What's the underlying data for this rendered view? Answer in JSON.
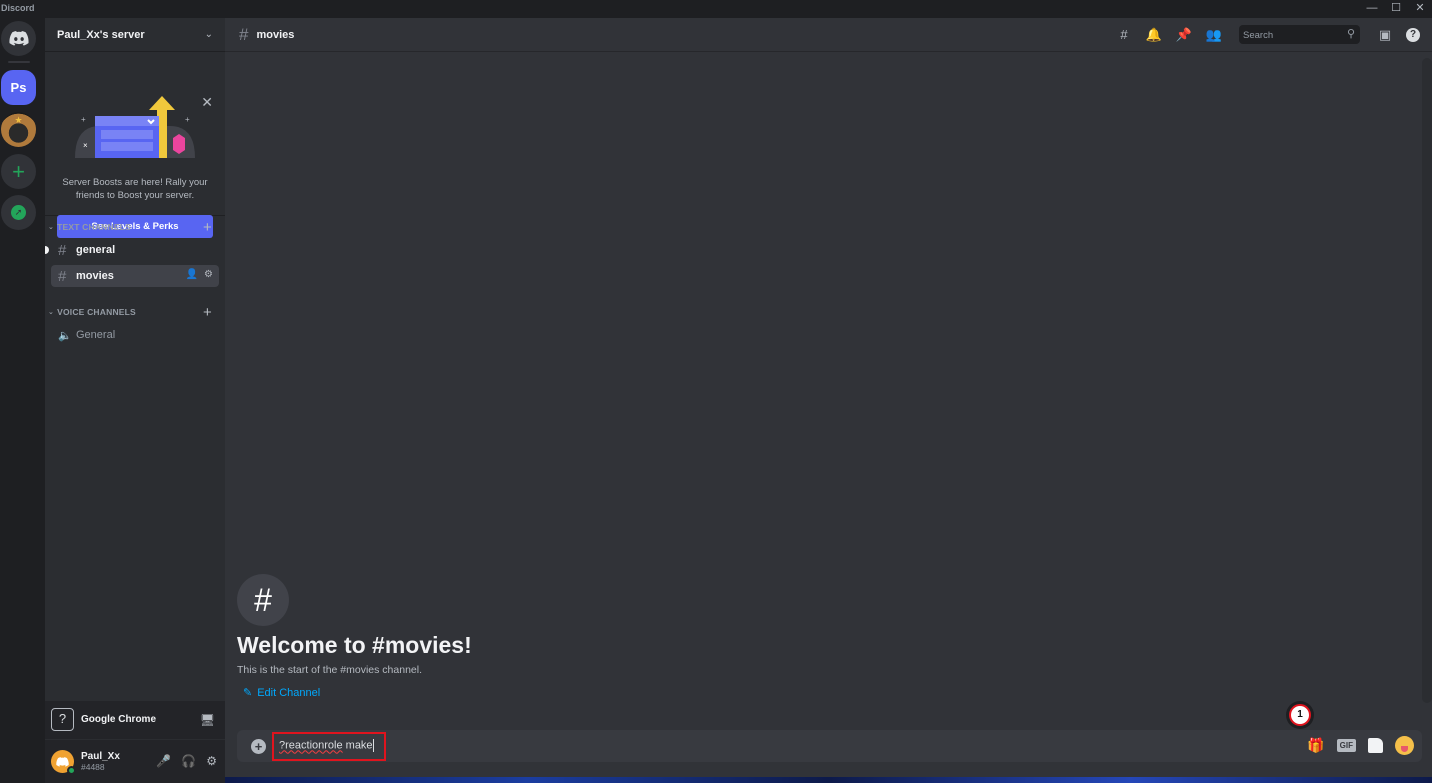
{
  "window": {
    "app_name": "Discord",
    "controls": {
      "minimize": "—",
      "maximize": "☐",
      "close": "✕"
    }
  },
  "guilds": {
    "home_icon": "discord-logo-icon",
    "items": [
      {
        "label": "Ps",
        "selected": true
      },
      {
        "label": "",
        "icon": "server-avatar-image"
      }
    ],
    "add_label": "+",
    "explore_icon": "compass-icon"
  },
  "server": {
    "name": "Paul_Xx's server",
    "chevron": "⌄"
  },
  "boost_banner": {
    "close": "✕",
    "text": "Server Boosts are here! Rally your friends to Boost your server.",
    "button": "See Levels & Perks"
  },
  "channels": {
    "text_category": "TEXT CHANNELS",
    "voice_category": "VOICE CHANNELS",
    "text": [
      {
        "name": "general",
        "unread": true,
        "selected": false
      },
      {
        "name": "movies",
        "unread": false,
        "selected": true
      }
    ],
    "voice": [
      {
        "name": "General"
      }
    ]
  },
  "activity": {
    "icon": "?",
    "name": "Google Chrome"
  },
  "user": {
    "name": "Paul_Xx",
    "tag": "#4488",
    "status": "online",
    "status_color": "#23a55a"
  },
  "header": {
    "channel": "movies",
    "search_placeholder": "Search"
  },
  "welcome": {
    "title": "Welcome to #movies!",
    "subtitle": "This is the start of the #movies channel.",
    "edit_link": "Edit Channel"
  },
  "composer": {
    "text_misspelled": "?reactionrole",
    "text_rest": " make",
    "gif_label": "GIF"
  },
  "annotation": {
    "step_number": "1",
    "highlight_color": "#e0141e"
  },
  "colors": {
    "accent": "#5865f2",
    "link": "#00a8fc",
    "add_green": "#23a55a"
  }
}
